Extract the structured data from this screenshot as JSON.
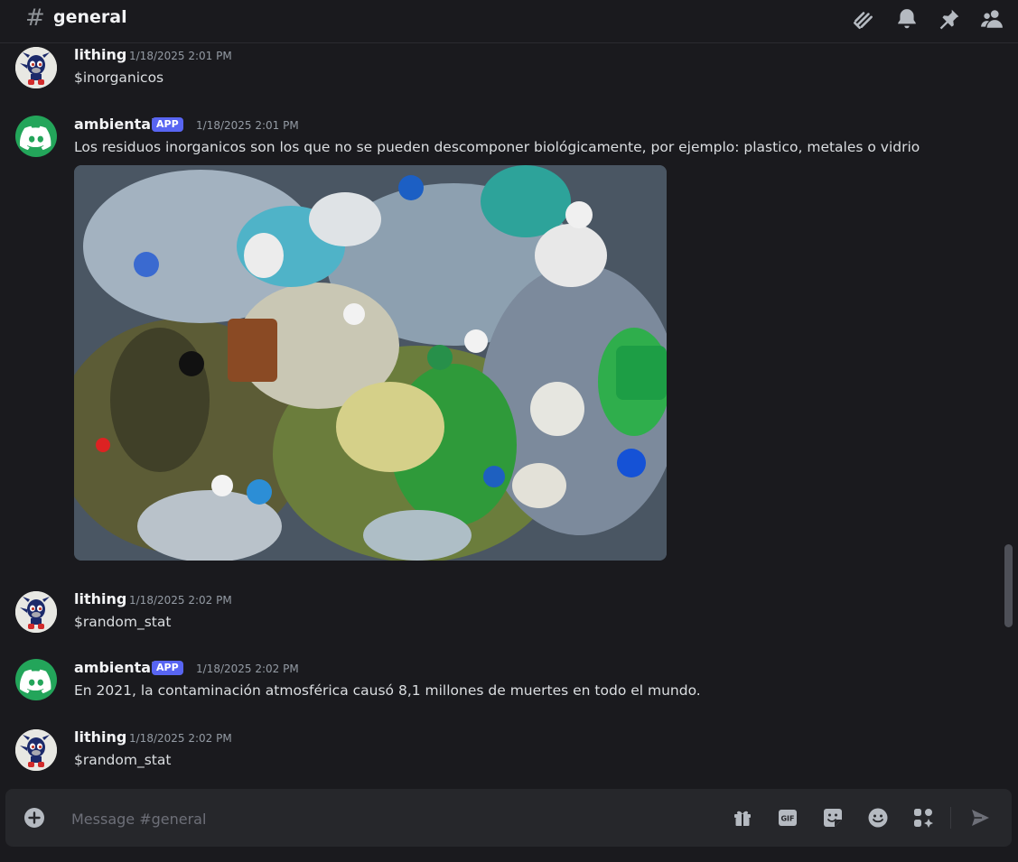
{
  "channel": {
    "name": "general",
    "hash_icon": "#"
  },
  "header_icons": [
    "threads-icon",
    "bell-icon",
    "pin-icon",
    "members-icon"
  ],
  "messages": [
    {
      "author": "lithing",
      "timestamp": "1/18/2025 2:01 PM",
      "content": "$inorganicos",
      "avatar": "sonic-avatar"
    },
    {
      "author": "ambiental",
      "badge": "APP",
      "timestamp": "1/18/2025 2:01 PM",
      "content": "Los residuos inorganicos son los que no se pueden descomponer biológicamente, por ejemplo: plastico, metales o vidrio",
      "avatar": "discord-logo-avatar",
      "attachment": "plastic-waste-photo"
    },
    {
      "author": "lithing",
      "timestamp": "1/18/2025 2:02 PM",
      "content": "$random_stat",
      "avatar": "sonic-avatar"
    },
    {
      "author": "ambiental",
      "badge": "APP",
      "timestamp": "1/18/2025 2:02 PM",
      "content": "En 2021, la contaminación atmosférica causó 8,1 millones de muertes en todo el mundo.",
      "avatar": "discord-logo-avatar"
    },
    {
      "author": "lithing",
      "timestamp": "1/18/2025 2:02 PM",
      "content": "$random_stat",
      "avatar": "sonic-avatar"
    }
  ],
  "composer": {
    "placeholder": "Message #general",
    "gif_label": "GIF",
    "icons": [
      "add-icon",
      "gift-icon",
      "gif-icon",
      "sticker-icon",
      "emoji-icon",
      "apps-icon",
      "send-icon"
    ]
  },
  "colors": {
    "background": "#1a1a1e",
    "bot_avatar": "#23a55a",
    "badge": "#5865f2"
  }
}
